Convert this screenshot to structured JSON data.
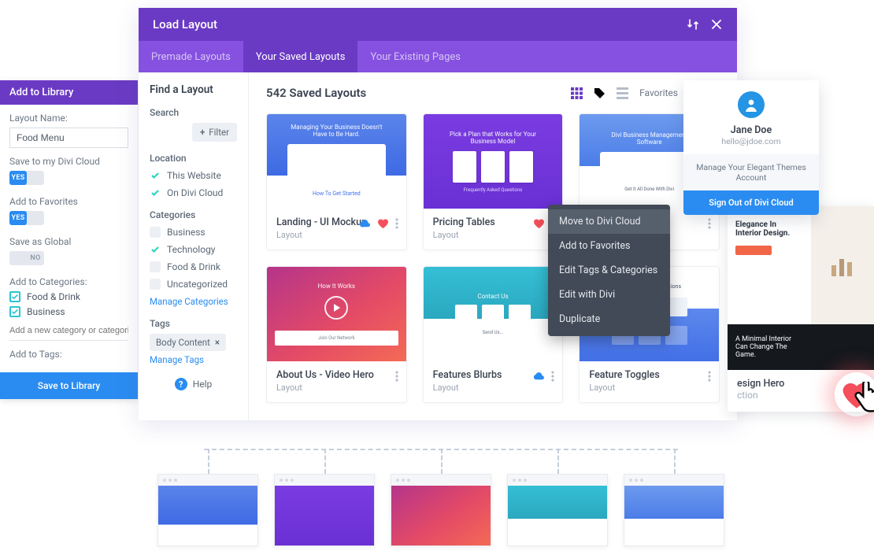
{
  "library_panel": {
    "title": "Add to Library",
    "name_label": "Layout Name:",
    "name_value": "Food Menu",
    "save_cloud_label": "Save to my Divi Cloud",
    "save_cloud_on": "YES",
    "favorites_label": "Add to Favorites",
    "favorites_on": "YES",
    "global_label": "Save as Global",
    "global_off": "NO",
    "categories_label": "Add to Categories:",
    "categories": [
      "Food & Drink",
      "Business"
    ],
    "category_placeholder": "Add a new category or categories",
    "tags_label": "Add to Tags:",
    "save_btn": "Save to Library"
  },
  "main": {
    "title": "Load Layout",
    "tabs": [
      "Premade Layouts",
      "Your Saved Layouts",
      "Your Existing Pages"
    ],
    "active_tab": 1,
    "filters": {
      "heading": "Find a Layout",
      "search_label": "Search",
      "filter_btn": "Filter",
      "location_label": "Location",
      "locations": [
        {
          "label": "This Website",
          "checked": true
        },
        {
          "label": "On Divi Cloud",
          "checked": true
        }
      ],
      "categories_label": "Categories",
      "categories": [
        {
          "label": "Business",
          "checked": false
        },
        {
          "label": "Technology",
          "checked": true
        },
        {
          "label": "Food & Drink",
          "checked": false
        },
        {
          "label": "Uncategorized",
          "checked": false
        }
      ],
      "manage_categories": "Manage Categories",
      "tags_label": "Tags",
      "tag_pill": "Body Content",
      "manage_tags": "Manage Tags",
      "help": "Help"
    },
    "content": {
      "count": "542 Saved Layouts",
      "sort": "Favorites",
      "cards": [
        {
          "title": "Landing - UI Mockup",
          "sub": "Layout",
          "thumb": "blue",
          "cloud": true,
          "heart": true
        },
        {
          "title": "Pricing Tables",
          "sub": "Layout",
          "thumb": "purple",
          "heart": true
        },
        {
          "title": "",
          "sub": "",
          "thumb": "bluewhite"
        },
        {
          "title": "About Us - Video Hero",
          "sub": "Layout",
          "thumb": "redgrad"
        },
        {
          "title": "Features Blurbs",
          "sub": "Layout",
          "thumb": "teal",
          "cloud": true
        },
        {
          "title": "Feature Toggles",
          "sub": "Layout",
          "thumb": "bluew2"
        }
      ]
    }
  },
  "context_menu": [
    "Move to Divi Cloud",
    "Add to Favorites",
    "Edit Tags & Categories",
    "Edit with Divi",
    "Duplicate"
  ],
  "context_hover_index": 0,
  "account": {
    "name": "Jane Doe",
    "email": "hello@jdoe.com",
    "manage": "Manage Your Elegant Themes Account",
    "signout": "Sign Out of Divi Cloud"
  },
  "preview": {
    "title1": "Elegance In",
    "title2": "Interior Design.",
    "dark1": "A Minimal Interior",
    "dark2": "Can Change The",
    "dark3": "Game.",
    "meta_title": "esign Hero",
    "meta_sub": "ction"
  }
}
